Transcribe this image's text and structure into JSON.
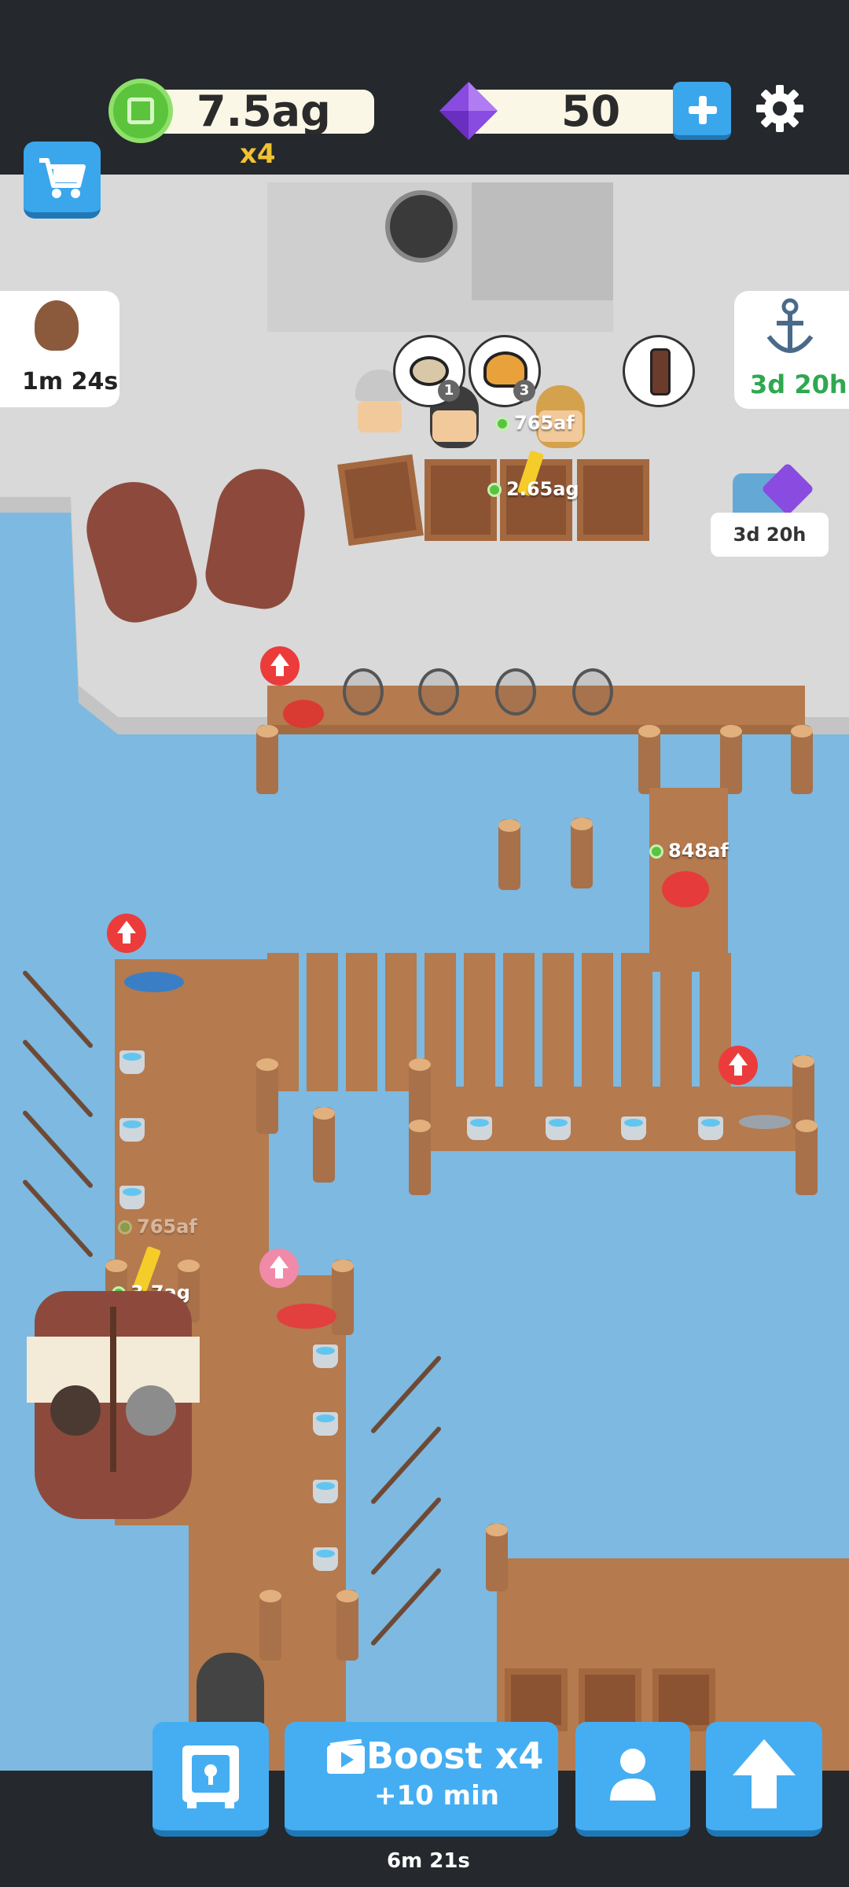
{
  "hud": {
    "coins": "7.5ag",
    "coin_multiplier": "x4",
    "gems": "50",
    "coin_icon": "green-coin-icon",
    "gem_icon": "purple-gem-icon",
    "settings_icon": "gear-icon",
    "shop_icon": "cart-icon"
  },
  "side": {
    "left_event_timer": "1m 24s",
    "right_event_timer": "3d 20h",
    "chest_timer": "3d 20h"
  },
  "world": {
    "counter_earnings": "765af",
    "crate_earnings": "2.65ag",
    "dock_earnings": "848af",
    "pier_earnings_faded": "765af",
    "pier_earnings": "3.7ag",
    "order_counts": [
      "1",
      "3"
    ]
  },
  "bottom": {
    "boost_title": "Boost x4",
    "boost_sub": "+10 min",
    "boost_timer": "6m 21s",
    "vault_icon": "safe-icon",
    "staff_icon": "person-icon",
    "upgrade_icon": "up-arrow-icon"
  },
  "colors": {
    "water": "#7db9e0",
    "wood": "#b57a4e",
    "button_blue": "#45aef2",
    "accent_gold": "#f1c232",
    "accent_green": "#2fa84f"
  }
}
